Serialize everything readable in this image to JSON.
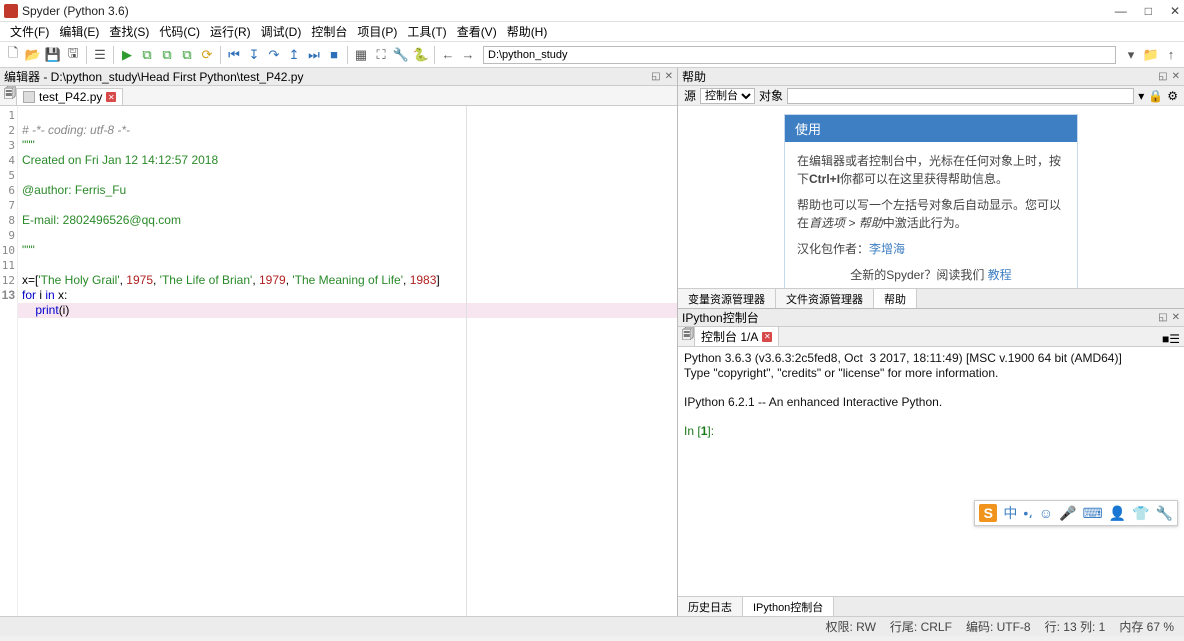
{
  "title": "Spyder (Python 3.6)",
  "menu": [
    "文件(F)",
    "编辑(E)",
    "查找(S)",
    "代码(C)",
    "运行(R)",
    "调试(D)",
    "控制台",
    "项目(P)",
    "工具(T)",
    "查看(V)",
    "帮助(H)"
  ],
  "path": "D:\\python_study",
  "editor": {
    "header": "编辑器 - D:\\python_study\\Head First Python\\test_P42.py",
    "tab": "test_P42.py",
    "lines": [
      {
        "n": 1,
        "t": "comment",
        "txt": "# -*- coding: utf-8 -*-"
      },
      {
        "n": 2,
        "t": "str",
        "txt": "\"\"\""
      },
      {
        "n": 3,
        "t": "str",
        "txt": "Created on Fri Jan 12 14:12:57 2018"
      },
      {
        "n": 4,
        "t": "str",
        "txt": ""
      },
      {
        "n": 5,
        "t": "str",
        "txt": "@author: Ferris_Fu"
      },
      {
        "n": 6,
        "t": "str",
        "txt": ""
      },
      {
        "n": 7,
        "t": "str",
        "txt": "E-mail: 2802496526@qq.com"
      },
      {
        "n": 8,
        "t": "str",
        "txt": ""
      },
      {
        "n": 9,
        "t": "str",
        "txt": "\"\"\""
      },
      {
        "n": 10,
        "t": "",
        "txt": ""
      },
      {
        "n": 11,
        "t": "code",
        "txt": "x=['The Holy Grail', 1975, 'The Life of Brian', 1979, 'The Meaning of Life', 1983]"
      },
      {
        "n": 12,
        "t": "for",
        "txt": "for i in x:"
      },
      {
        "n": 13,
        "t": "print",
        "txt": "    print(i)",
        "hl": true
      }
    ]
  },
  "help": {
    "title": "帮助",
    "src_label": "源",
    "src_value": "控制台",
    "obj_label": "对象",
    "card_title": "使用",
    "p1a": "在编辑器或者控制台中，光标在任何对象上时，按下",
    "p1b": "Ctrl+I",
    "p1c": "你都可以在这里获得帮助信息。",
    "p2a": "帮助也可以写一个左括号对象后自动显示。您可以在",
    "p2b": "首选项 > 帮助",
    "p2c": "中激活此行为。",
    "p3a": "汉化包作者：",
    "p3link": "李增海",
    "p4a": "全新的Spyder？阅读我们",
    "p4link": "教程",
    "tabs": [
      "变量资源管理器",
      "文件资源管理器",
      "帮助"
    ]
  },
  "console": {
    "title": "IPython控制台",
    "tab": "控制台 1/A",
    "out1": "Python 3.6.3 (v3.6.3:2c5fed8, Oct  3 2017, 18:11:49) [MSC v.1900 64 bit (AMD64)]",
    "out2": "Type \"copyright\", \"credits\" or \"license\" for more information.",
    "out3": "IPython 6.2.1 -- An enhanced Interactive Python.",
    "prompt": "In [1]: ",
    "tabs": [
      "历史日志",
      "IPython控制台"
    ]
  },
  "status": {
    "perm": "权限:  RW",
    "eol": "行尾:  CRLF",
    "enc": "编码:  UTF-8",
    "pos": "行:  13   列:  1",
    "mem": "内存   67 %"
  },
  "float": {
    "s": "S",
    "cn": "中"
  }
}
